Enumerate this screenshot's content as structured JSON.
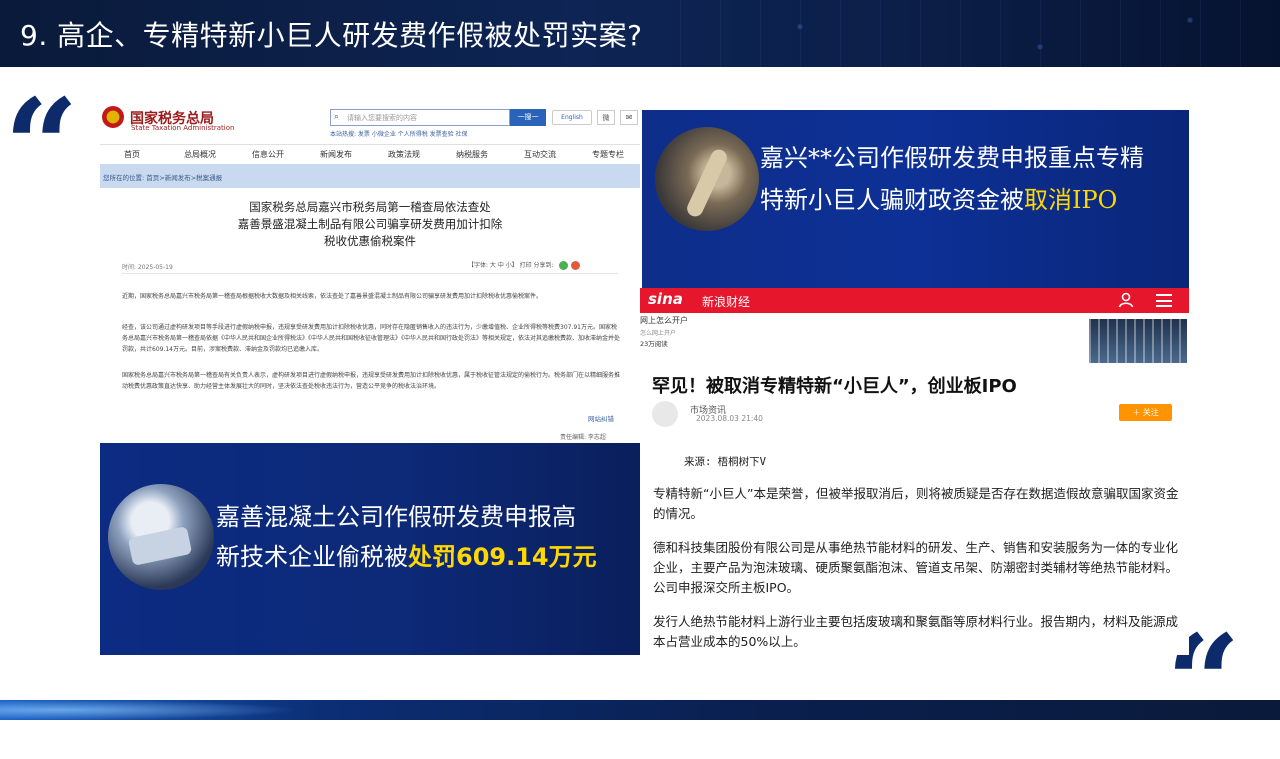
{
  "slide": {
    "title": "9. 高企、专精特新小巨人研发费作假被处罚实案?",
    "quote_open": "“",
    "quote_close": "“"
  },
  "tax_page": {
    "logo": "国家税务总局",
    "logo_en": "State Taxation Administration",
    "search_placeholder": "请输入您要搜索的内容",
    "search_button": "一搜一",
    "english_button": "English",
    "icon_a": "微",
    "icon_b": "✉",
    "hot_searches": "本站热搜: 发票 小微企业 个人所得税 发票查验 社保",
    "nav": [
      "首页",
      "总局概况",
      "信息公开",
      "新闻发布",
      "政策法规",
      "纳税服务",
      "互动交流",
      "专题专栏"
    ],
    "breadcrumb": "您所在的位置: 首页>新闻发布>税案通报",
    "headline": [
      "国家税务总局嘉兴市税务局第一稽查局依法查处",
      "嘉善景盛混凝土制品有限公司骗享研发费用加计扣除",
      "税收优惠偷税案件"
    ],
    "time": "时间: 2025-05-19",
    "font_ctrl": "【字体: 大 中 小】  打印  分享到:",
    "paragraphs": [
      "近期，国家税务总局嘉兴市税务局第一稽查局根据税收大数据及相关线索，依法查处了嘉善景盛混凝土制品有限公司骗享研发费用加计扣除税收优惠偷税案件。",
      "经查，该公司通过虚构研发项目等手段进行虚假纳税申报，违规享受研发费用加计扣除税收优惠，同时存在隐匿销售收入的违法行为，少缴增值税、企业所得税等税费307.91万元。国家税务总局嘉兴市税务局第一稽查局依据《中华人民共和国企业所得税法》《中华人民共和国税收征收管理法》《中华人民共和国行政处罚法》等相关规定，依法对其追缴税费款、加收滞纳金并处罚款，共计609.14万元。目前，涉案税费款、滞纳金及罚款均已追缴入库。",
      "国家税务总局嘉兴市税务局第一稽查局有关负责人表示，虚构研发项目进行虚假纳税申报，违规享受研发费用加计扣除税收优惠，属于税收征管法规定的偷税行为。税务部门在以精细服务推动税费优惠政策直达快享、助力经营主体发展壮大的同时，坚决依法查处税收违法行为，营造公平竞争的税收法治环境。"
    ],
    "editor": "网站纠错",
    "responsible": "责任编辑:  李志超"
  },
  "banner_left": {
    "line1": "嘉善混凝土公司作假研发费申报高",
    "line2_plain": "新技术企业偷税被",
    "line2_highlight": "处罚609.14万元"
  },
  "banner_right": {
    "line1": "嘉兴**公司作假研发费申报重点专精",
    "line2_plain": "特新小巨人骗财政资金被",
    "line2_highlight": "取消IPO"
  },
  "sina": {
    "logo": "sina",
    "channel": "新浪财经",
    "ad_title": "网上怎么开户",
    "ad_sub1": "怎么网上开户",
    "ad_sub2": "23万阅读",
    "title": "罕见！被取消专精特新“小巨人”，创业板IPO",
    "author": "市场资讯",
    "date": "2023.08.03  21:40",
    "follow": "＋ 关注",
    "source": "来源: 梧桐树下V",
    "paragraphs": [
      "专精特新“小巨人”本是荣誉，但被举报取消后，则将被质疑是否存在数据造假故意骗取国家资金的情况。",
      "德和科技集团股份有限公司是从事绝热节能材料的研发、生产、销售和安装服务为一体的专业化企业，主要产品为泡沫玻璃、硬质聚氨酯泡沫、管道支吊架、防潮密封类辅材等绝热节能材料。公司申报深交所主板IPO。",
      "发行人绝热节能材料上游行业主要包括废玻璃和聚氨酯等原材料行业。报告期内，材料及能源成本占营业成本的50%以上。"
    ]
  },
  "colors": {
    "header_bg": "#0d2454",
    "banner_blue": "#0d2a78",
    "highlight_yellow": "#ffd800",
    "sina_red": "#e6162d",
    "follow_orange": "#ff9300",
    "quote_navy": "#0d2a6b"
  }
}
